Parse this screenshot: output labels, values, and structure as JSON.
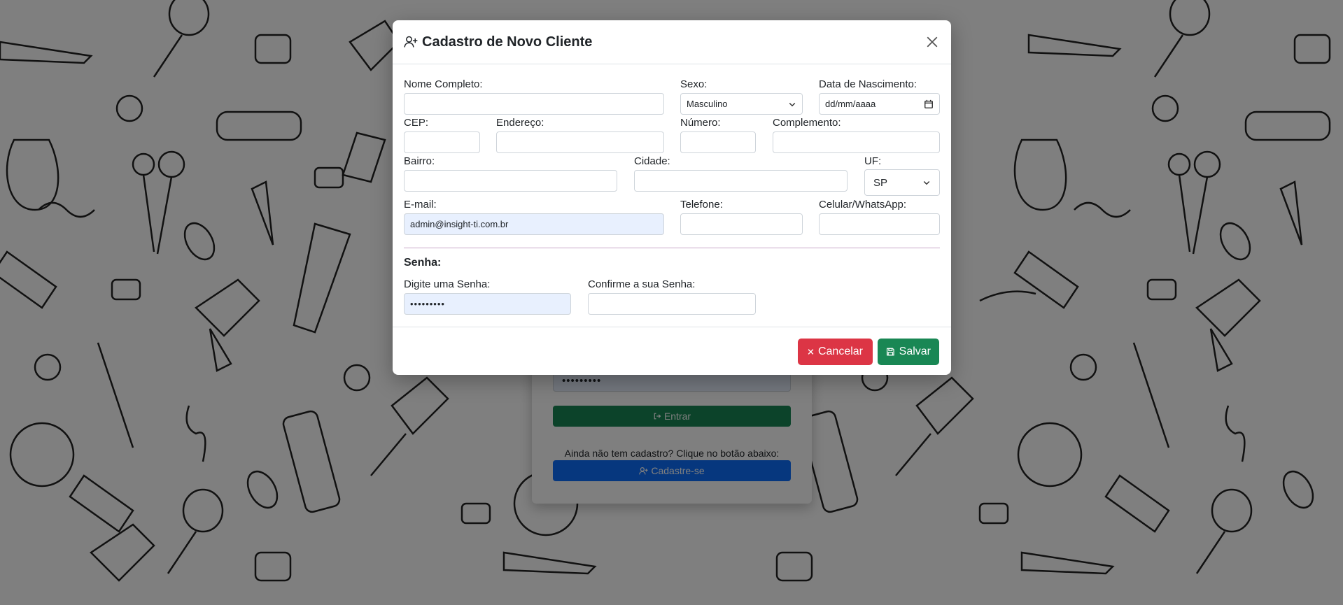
{
  "login": {
    "password_value": "•••••••••",
    "enter_label": "Entrar",
    "signup_hint": "Ainda não tem cadastro? Clique no botão abaixo:",
    "signup_label": "Cadastre-se"
  },
  "modal": {
    "title": "Cadastro de Novo Cliente",
    "fields": {
      "nome_label": "Nome Completo:",
      "nome_value": "",
      "sexo_label": "Sexo:",
      "sexo_value": "Masculino",
      "nascimento_label": "Data de Nascimento:",
      "nascimento_placeholder": "dd/mm/aaaa",
      "cep_label": "CEP:",
      "endereco_label": "Endereço:",
      "numero_label": "Número:",
      "complemento_label": "Complemento:",
      "bairro_label": "Bairro:",
      "cidade_label": "Cidade:",
      "uf_label": "UF:",
      "uf_value": "SP",
      "email_label": "E-mail:",
      "email_value": "admin@insight-ti.com.br",
      "telefone_label": "Telefone:",
      "celular_label": "Celular/WhatsApp:"
    },
    "senha": {
      "section_title": "Senha:",
      "senha_label": "Digite uma Senha:",
      "senha_value": "•••••••••",
      "confirma_label": "Confirme a sua Senha:"
    },
    "footer": {
      "cancel_label": "Cancelar",
      "save_label": "Salvar"
    }
  },
  "colors": {
    "danger": "#dc3545",
    "success": "#198754",
    "primary": "#0d6efd",
    "autofill": "#e8f0fe"
  }
}
